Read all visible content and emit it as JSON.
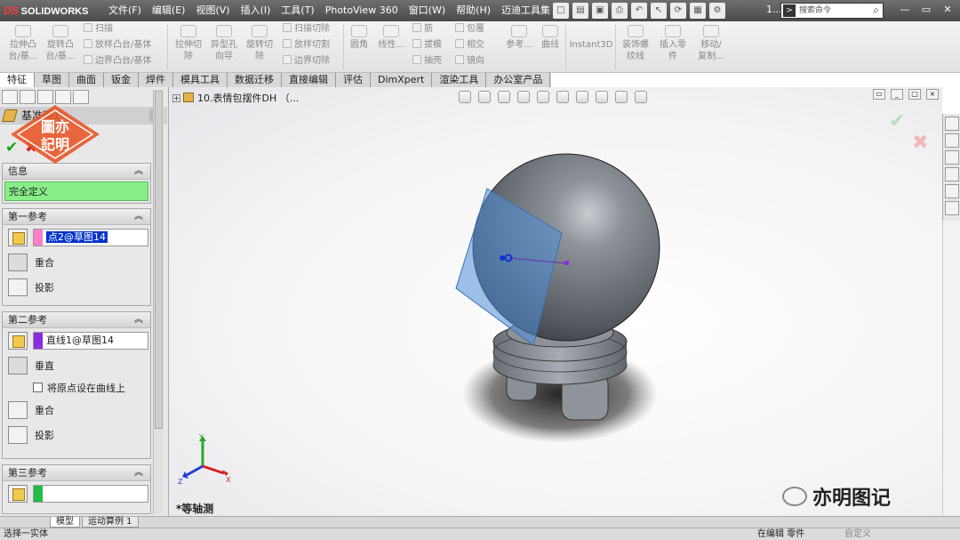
{
  "app": {
    "logo_text": "SOLIDWORKS",
    "logo_mark": "DS",
    "menus": [
      "文件(F)",
      "编辑(E)",
      "视图(V)",
      "插入(I)",
      "工具(T)",
      "PhotoView 360",
      "窗口(W)",
      "帮助(H)",
      "迈迪工具集"
    ],
    "title_right": "1...",
    "search_placeholder": "搜索命令",
    "window_buttons": [
      "—",
      "▭",
      "✕"
    ]
  },
  "ribbon": {
    "buttons": [
      {
        "label": "拉伸凸\n台/基..."
      },
      {
        "label": "旋转凸\n台/基..."
      },
      {
        "label": "拉伸切\n除"
      },
      {
        "label": "异型孔\n向导"
      },
      {
        "label": "旋转切\n除"
      },
      {
        "label": "圆角"
      },
      {
        "label": "线性..."
      },
      {
        "label": "参考..."
      },
      {
        "label": "曲线"
      },
      {
        "label": "Instant3D"
      },
      {
        "label": "装饰螺\n纹线"
      },
      {
        "label": "插入零\n件"
      },
      {
        "label": "移动/\n复制..."
      }
    ],
    "small_buttons": [
      "扫描",
      "放样凸台/基体",
      "边界凸台/基体",
      "扫描切除",
      "放样切割",
      "边界切除",
      "筋",
      "拔模",
      "抽壳",
      "包覆",
      "相交",
      "镜向"
    ]
  },
  "tabs": [
    "特征",
    "草图",
    "曲面",
    "钣金",
    "焊件",
    "模具工具",
    "数据迁移",
    "直接编辑",
    "评估",
    "DimXpert",
    "渲染工具",
    "办公室产品"
  ],
  "active_tab": "特征",
  "property_manager": {
    "title": "基准面1",
    "help": "?",
    "ok_symbol": "✔",
    "cancel_symbol": "✖",
    "info": {
      "header": "信息",
      "status": "完全定义",
      "status_color": "#88ee88"
    },
    "first_ref": {
      "header": "第一参考",
      "value": "点2@草图14",
      "swatch_color": "#ff7fc8",
      "options": [
        "重合",
        "投影"
      ]
    },
    "second_ref": {
      "header": "第二参考",
      "value": "直线1@草图14",
      "swatch_color": "#8a2be2",
      "options": [
        "垂直",
        "重合",
        "投影"
      ],
      "checkbox_label": "将原点设在曲线上",
      "checkbox_checked": false
    },
    "third_ref": {
      "header": "第三参考",
      "value": "",
      "swatch_color": "#22bb44"
    }
  },
  "viewport": {
    "tree_root": "10.表情包摆件DH （...",
    "view_label": "*等轴测",
    "triad_labels": [
      "Y",
      "X",
      "Z"
    ]
  },
  "bottom_tabs": [
    "模型",
    "运动算例 1"
  ],
  "status": {
    "left": "选择一实体",
    "right": "在编辑 零件",
    "right2": "自定义"
  },
  "watermark": {
    "stamp_text": "亦明圖記",
    "brand_text": "亦明图记",
    "brand_tail": "记"
  },
  "colors": {
    "sphere": "#5f646b",
    "plane": "#4f8fd8",
    "status_green": "#88ee88",
    "ok_green": "#1aa31a",
    "cancel_red": "#d42020",
    "stamp_orange": "#e8582a"
  }
}
